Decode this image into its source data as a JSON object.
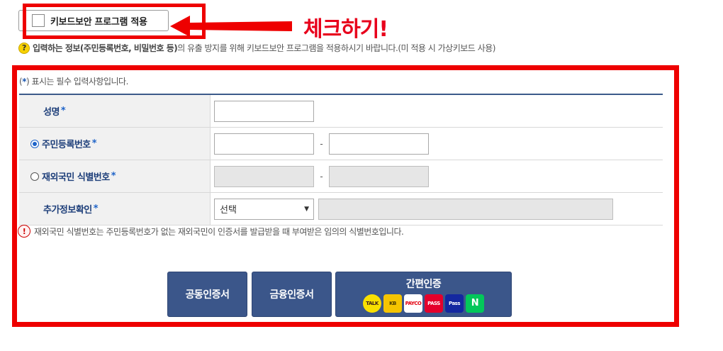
{
  "keyboard_security": {
    "label": "키보드보안 프로그램 적용",
    "annotation": "체크하기!"
  },
  "help_text": {
    "lead": "입력하는 정보(주민등록번호, 비밀번호 등)",
    "rest": "의 유출 방지를 위해 키보드보안 프로그램을 적용하시기 바랍니다.(미 적용 시 가상키보드 사용)"
  },
  "form": {
    "required_note": {
      "open": "(",
      "star": "*",
      "rest": ") 표시는 필수 입력사항입니다."
    },
    "rows": [
      {
        "label": "성명",
        "required": "*"
      },
      {
        "label": "주민등록번호",
        "required": "*",
        "selected": true,
        "separator": "-"
      },
      {
        "label": "재외국민 식별번호",
        "required": "*",
        "selected": false,
        "separator": "-"
      },
      {
        "label": "추가정보확인",
        "required": "*",
        "select_value": "선택",
        "caret": "▼"
      }
    ]
  },
  "notice": {
    "icon": "!",
    "text": "재외국민 식별번호는 주민등록번호가 없는 재외국민이 인증서를 발급받을 때 부여받은 임의의 식별번호입니다."
  },
  "buttons": {
    "joint_cert": "공동인증서",
    "financial_cert": "금융인증서",
    "simple_auth": "간편인증",
    "providers": [
      "TALK",
      "KB",
      "PAYCO",
      "PASS",
      "Pass",
      "N"
    ]
  },
  "colors": {
    "highlight_red": "#ee0000",
    "annotation_red": "#e8001c",
    "button_navy": "#3b568a",
    "label_navy": "#1e3f7a",
    "required_blue": "#1e63c8"
  }
}
